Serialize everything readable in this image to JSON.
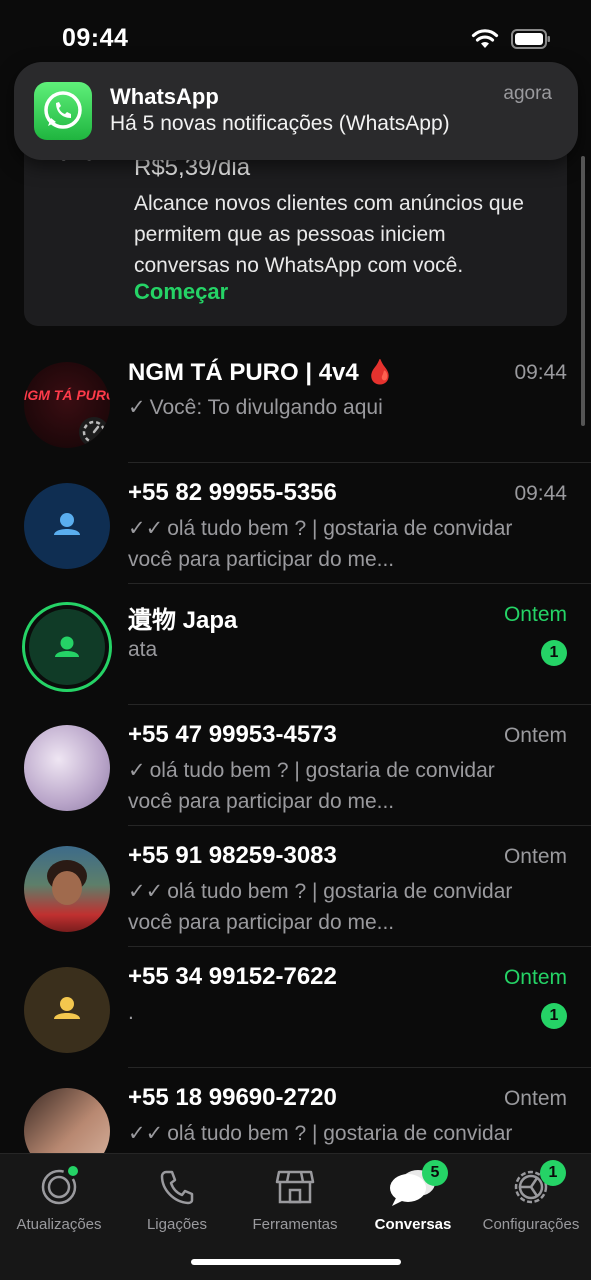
{
  "status_bar": {
    "time": "09:44"
  },
  "notification": {
    "app_name": "WhatsApp",
    "time": "agora",
    "body": "Há 5 novas notificações (WhatsApp)",
    "icon": "whatsapp-logo-icon"
  },
  "promo": {
    "price": "R$5,39/dia",
    "text": "Alcance novos clientes com anúncios que permitem que as pessoas iniciem conversas no WhatsApp com você.",
    "link": "Começar"
  },
  "chats": [
    {
      "name": "NGM TÁ PURO | 4v4 🩸",
      "time": "09:44",
      "tick": "✓",
      "sender": "Você:",
      "preview": "To divulgando aqui",
      "unread": "",
      "avatar": "group-photo",
      "avatar_text": "NGM TÁ PURO",
      "time_unread": false
    },
    {
      "name": "+55 82 99955-5356",
      "time": "09:44",
      "tick": "✓✓",
      "sender": "",
      "preview": "olá tudo bem ? | gostaria de convidar você para participar do me...",
      "unread": "",
      "avatar": "default-blue",
      "time_unread": false
    },
    {
      "name": "遺物 Japa",
      "time": "Ontem",
      "tick": "",
      "sender": "",
      "preview": "ata",
      "unread": "1",
      "avatar": "default-green-ring",
      "time_unread": true
    },
    {
      "name": "+55 47 99953-4573",
      "time": "Ontem",
      "tick": "✓",
      "sender": "",
      "preview": "olá tudo bem ? | gostaria de convidar você para participar do me...",
      "unread": "",
      "avatar": "photo-lavender",
      "time_unread": false
    },
    {
      "name": "+55 91 98259-3083",
      "time": "Ontem",
      "tick": "✓✓",
      "sender": "",
      "preview": "olá tudo bem ? | gostaria de convidar você para participar do me...",
      "unread": "",
      "avatar": "photo-person",
      "time_unread": false
    },
    {
      "name": "+55 34 99152-7622",
      "time": "Ontem",
      "tick": "",
      "sender": "",
      "preview": ".",
      "unread": "1",
      "avatar": "default-yellow",
      "time_unread": true
    },
    {
      "name": "+55 18 99690-2720",
      "time": "Ontem",
      "tick": "✓✓",
      "sender": "",
      "preview": "olá tudo bem ? | gostaria de convidar você para participar do me...",
      "unread": "",
      "avatar": "photo-person-2",
      "time_unread": false
    }
  ],
  "tabs": [
    {
      "label": "Atualizações",
      "icon": "updates-icon",
      "badge": "",
      "dot": true,
      "active": false
    },
    {
      "label": "Ligações",
      "icon": "phone-icon",
      "badge": "",
      "dot": false,
      "active": false
    },
    {
      "label": "Ferramentas",
      "icon": "store-icon",
      "badge": "",
      "dot": false,
      "active": false
    },
    {
      "label": "Conversas",
      "icon": "chats-icon",
      "badge": "5",
      "dot": false,
      "active": true
    },
    {
      "label": "Configurações",
      "icon": "settings-icon",
      "badge": "1",
      "dot": false,
      "active": false
    }
  ],
  "colors": {
    "accent": "#25d366",
    "background": "#0b0b0b",
    "muted": "#9a9a9e"
  }
}
